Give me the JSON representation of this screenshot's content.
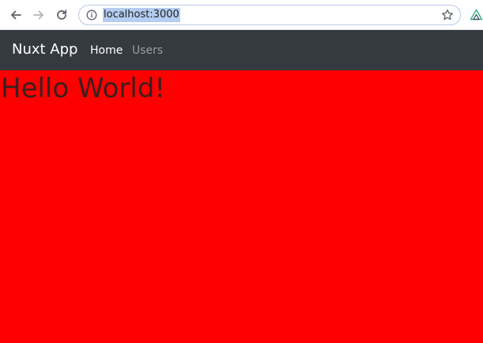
{
  "browser": {
    "url": "localhost:3000",
    "icons": {
      "back": "back-arrow-icon",
      "forward": "forward-arrow-icon",
      "reload": "reload-icon",
      "site_info": "info-icon",
      "bookmark": "star-icon",
      "extension": "triangle-extension-icon"
    }
  },
  "navbar": {
    "brand": "Nuxt App",
    "links": [
      {
        "label": "Home",
        "active": true
      },
      {
        "label": "Users",
        "active": false
      }
    ]
  },
  "main": {
    "heading": "Hello World!"
  },
  "colors": {
    "navbar_bg": "#343a40",
    "page_bg": "#ff0000",
    "active_link": "#ffffff",
    "inactive_link": "#9a9da1",
    "url_highlight": "#b4cdf0"
  }
}
